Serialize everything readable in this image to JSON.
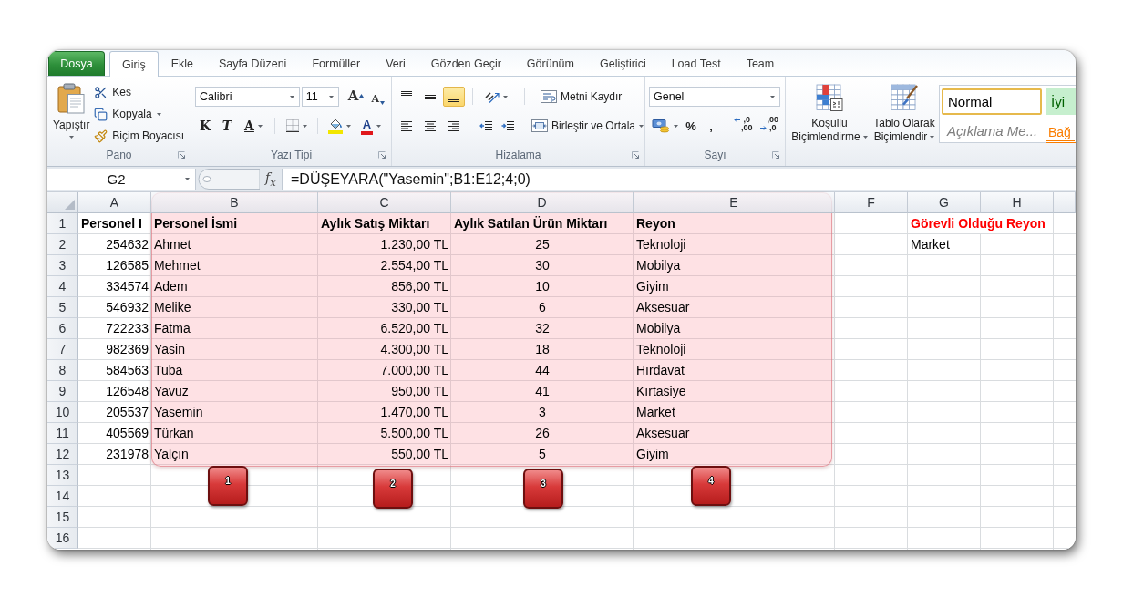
{
  "ribbon_tabs": [
    {
      "label": "Dosya",
      "kind": "file",
      "selected": false
    },
    {
      "label": "Giriş",
      "kind": "tab",
      "selected": true
    },
    {
      "label": "Ekle",
      "kind": "tab",
      "selected": false
    },
    {
      "label": "Sayfa Düzeni",
      "kind": "tab",
      "selected": false
    },
    {
      "label": "Formüller",
      "kind": "tab",
      "selected": false
    },
    {
      "label": "Veri",
      "kind": "tab",
      "selected": false
    },
    {
      "label": "Gözden Geçir",
      "kind": "tab",
      "selected": false
    },
    {
      "label": "Görünüm",
      "kind": "tab",
      "selected": false
    },
    {
      "label": "Geliştirici",
      "kind": "tab",
      "selected": false
    },
    {
      "label": "Load Test",
      "kind": "tab",
      "selected": false
    },
    {
      "label": "Team",
      "kind": "tab",
      "selected": false
    }
  ],
  "ribbon": {
    "clipboard": {
      "title": "Pano",
      "paste": "Yapıştır",
      "items": [
        {
          "label": "Kes",
          "kind": "cut",
          "dropdown": false
        },
        {
          "label": "Kopyala",
          "kind": "copy",
          "dropdown": true
        },
        {
          "label": "Biçim Boyacısı",
          "kind": "format_painter",
          "dropdown": false
        }
      ]
    },
    "font": {
      "title": "Yazı Tipi",
      "font_name": "Calibri",
      "font_size": "11",
      "grow": "A",
      "shrink": "A",
      "bold": "K",
      "italic": "T",
      "underline": "A",
      "font_color": "A"
    },
    "alignment": {
      "title": "Hizalama",
      "vertical": [
        {
          "kind": "top",
          "selected": false
        },
        {
          "kind": "middle",
          "selected": false
        },
        {
          "kind": "bottom",
          "selected": true
        }
      ],
      "horizontal": [
        {
          "kind": "left",
          "selected": false
        },
        {
          "kind": "center",
          "selected": false
        },
        {
          "kind": "right",
          "selected": false
        }
      ],
      "wrap_text": "Metni Kaydır",
      "merge": "Birleştir ve Ortala"
    },
    "number": {
      "title": "Sayı",
      "format": "Genel",
      "percent": "%",
      "comma": ",",
      "decimals": [
        {
          "kind": "increase",
          "top": ",0",
          "bottom": ",00"
        },
        {
          "kind": "decrease",
          "top": ",00",
          "bottom": ",0"
        }
      ]
    },
    "styles": {
      "commands": [
        {
          "label": "Koşullu Biçimlendirme",
          "kind": "conditional"
        },
        {
          "label": "Tablo Olarak Biçimlendir",
          "kind": "table"
        }
      ],
      "cell_styles": [
        {
          "label": "Normal",
          "kind": "normal",
          "selected": true
        },
        {
          "label": "İyi",
          "kind": "good",
          "selected": false
        },
        {
          "label": "Açıklama Me...",
          "kind": "explanatory",
          "selected": false
        },
        {
          "label": "Bağ",
          "kind": "linked",
          "selected": false
        }
      ]
    }
  },
  "formula_bar": {
    "name_box": "G2",
    "function_label": "f$_{x}$",
    "formula": "=DÜŞEYARA(\"Yasemin\";B1:E12;4;0)"
  },
  "sheet": {
    "columns": [
      "A",
      "B",
      "C",
      "D",
      "E",
      "F",
      "G",
      "H"
    ],
    "row_numbers": [
      "1",
      "2",
      "3",
      "4",
      "5",
      "6",
      "7",
      "8",
      "9",
      "10",
      "11",
      "12",
      "13",
      "14",
      "15",
      "16"
    ],
    "rows": [
      {
        "kind": "header",
        "cells": [
          "Personel I",
          "Personel İsmi",
          "Aylık Satış Miktarı",
          "Aylık Satılan Ürün Miktarı",
          "Reyon"
        ]
      },
      {
        "kind": "data",
        "cells": [
          "254632",
          "Ahmet",
          "1.230,00 TL",
          "25",
          "Teknoloji"
        ]
      },
      {
        "kind": "data",
        "cells": [
          "126585",
          "Mehmet",
          "2.554,00 TL",
          "30",
          "Mobilya"
        ]
      },
      {
        "kind": "data",
        "cells": [
          "334574",
          "Adem",
          "856,00 TL",
          "10",
          "Giyim"
        ]
      },
      {
        "kind": "data",
        "cells": [
          "546932",
          "Melike",
          "330,00 TL",
          "6",
          "Aksesuar"
        ]
      },
      {
        "kind": "data",
        "cells": [
          "722233",
          "Fatma",
          "6.520,00 TL",
          "32",
          "Mobilya"
        ]
      },
      {
        "kind": "data",
        "cells": [
          "982369",
          "Yasin",
          "4.300,00 TL",
          "18",
          "Teknoloji"
        ]
      },
      {
        "kind": "data",
        "cells": [
          "584563",
          "Tuba",
          "7.000,00 TL",
          "44",
          "Hırdavat"
        ]
      },
      {
        "kind": "data",
        "cells": [
          "126548",
          "Yavuz",
          "950,00 TL",
          "41",
          "Kırtasiye"
        ]
      },
      {
        "kind": "data",
        "cells": [
          "205537",
          "Yasemin",
          "1.470,00 TL",
          "3",
          "Market"
        ]
      },
      {
        "kind": "data",
        "cells": [
          "405569",
          "Türkan",
          "5.500,00 TL",
          "26",
          "Aksesuar"
        ]
      },
      {
        "kind": "data",
        "cells": [
          "231978",
          "Yalçın",
          "550,00 TL",
          "5",
          "Giyim"
        ]
      }
    ],
    "lookup_cells": [
      {
        "kind": "heading",
        "text": "Görevli Olduğu Reyon"
      },
      {
        "kind": "result",
        "text": "Market"
      }
    ]
  },
  "annotation": {
    "highlight": true,
    "markers": [
      "1",
      "2",
      "3",
      "4"
    ]
  }
}
